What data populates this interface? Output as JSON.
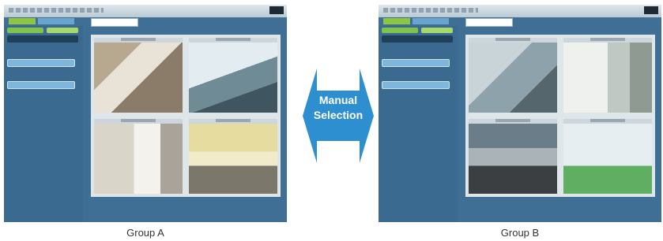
{
  "arrow": {
    "line1": "Manual",
    "line2": "Selection",
    "color": "#2e8fd0"
  },
  "groups": [
    {
      "caption": "Group A"
    },
    {
      "caption": "Group B"
    }
  ],
  "colors": {
    "screen_bg": "#3f6f94",
    "accent_green": "#8ec63f"
  }
}
